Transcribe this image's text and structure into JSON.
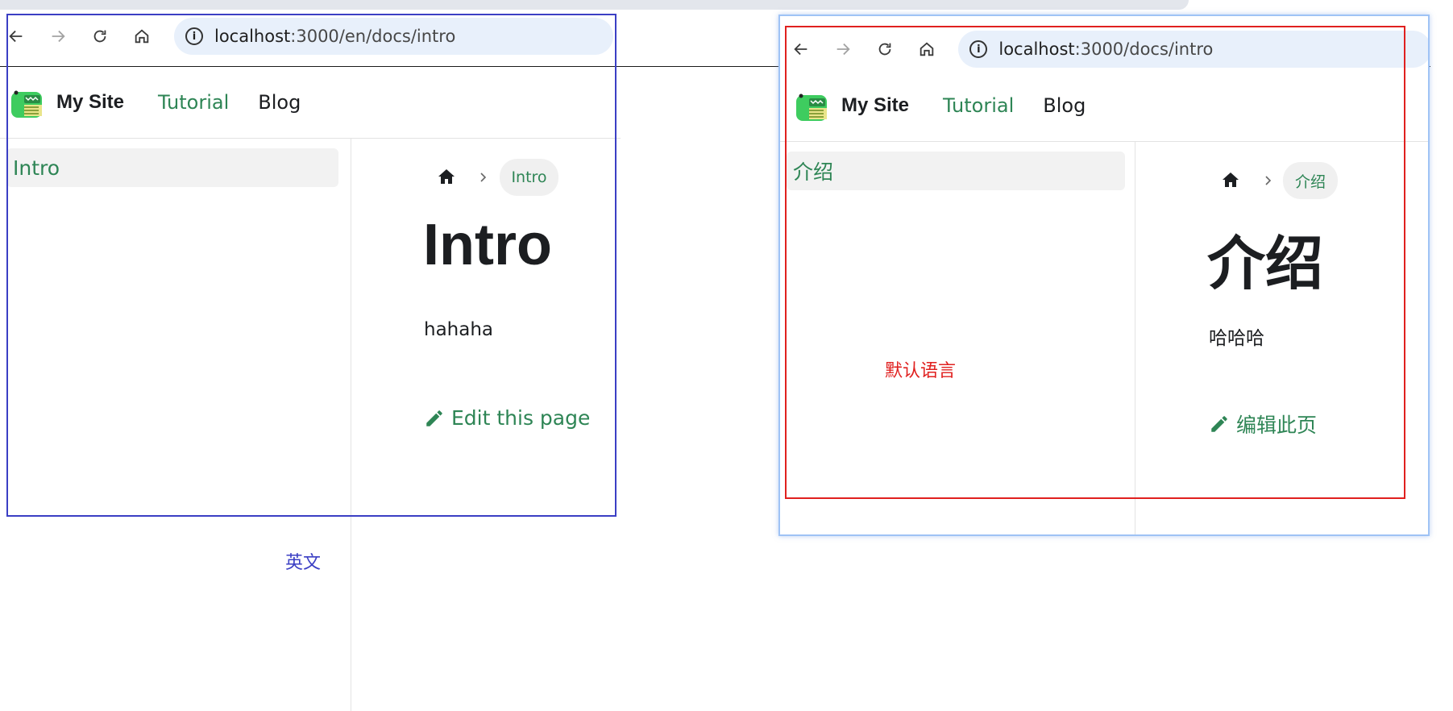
{
  "left": {
    "url_host": "localhost",
    "url_path": ":3000/en/docs/intro",
    "brand": "My Site",
    "nav_tutorial": "Tutorial",
    "nav_blog": "Blog",
    "sidebar_item": "Intro",
    "breadcrumb": "Intro",
    "title": "Intro",
    "body": "hahaha",
    "edit": "Edit this page"
  },
  "right": {
    "url_host": "localhost",
    "url_path": ":3000/docs/intro",
    "brand": "My Site",
    "nav_tutorial": "Tutorial",
    "nav_blog": "Blog",
    "sidebar_item": "介绍",
    "breadcrumb": "介绍",
    "title": "介绍",
    "body": "哈哈哈",
    "edit": "编辑此页"
  },
  "annotations": {
    "left_label": "英文",
    "right_label": "默认语言"
  },
  "colors": {
    "accent": "#2e8555",
    "left_frame": "#3b3fc4",
    "right_frame": "#e0201f",
    "right_window_border": "#9fc3f5"
  },
  "icons": [
    "back-icon",
    "forward-icon",
    "reload-icon",
    "home-icon",
    "site-info-icon",
    "breadcrumb-home-icon",
    "chevron-right-icon",
    "pencil-icon",
    "dinosaur-logo"
  ]
}
